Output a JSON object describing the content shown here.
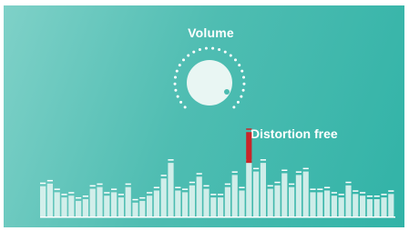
{
  "volume_label": "Volume",
  "callout_label": "Distortion free",
  "colors": {
    "background_start": "#7fd1c8",
    "background_end": "#31b3a7",
    "bar_fill": "#dff3ef",
    "bar_cap": "#ffffff",
    "peak_bar": "#c8262a",
    "knob": "#e9f6f3",
    "knob_indicator": "#4cbcb1"
  },
  "equalizer": {
    "icon": "equalizer-bars",
    "levels": [
      0.35,
      0.38,
      0.28,
      0.22,
      0.24,
      0.18,
      0.2,
      0.32,
      0.34,
      0.24,
      0.28,
      0.22,
      0.34,
      0.16,
      0.18,
      0.24,
      0.3,
      0.44,
      0.62,
      0.3,
      0.28,
      0.36,
      0.46,
      0.32,
      0.22,
      0.22,
      0.34,
      0.48,
      0.3,
      0.62,
      0.52,
      0.62,
      0.32,
      0.36,
      0.5,
      0.34,
      0.48,
      0.52,
      0.28,
      0.28,
      0.3,
      0.24,
      0.22,
      0.36,
      0.26,
      0.24,
      0.2,
      0.2,
      0.22,
      0.26
    ],
    "peak_index": 29,
    "peak_level": 0.85
  }
}
